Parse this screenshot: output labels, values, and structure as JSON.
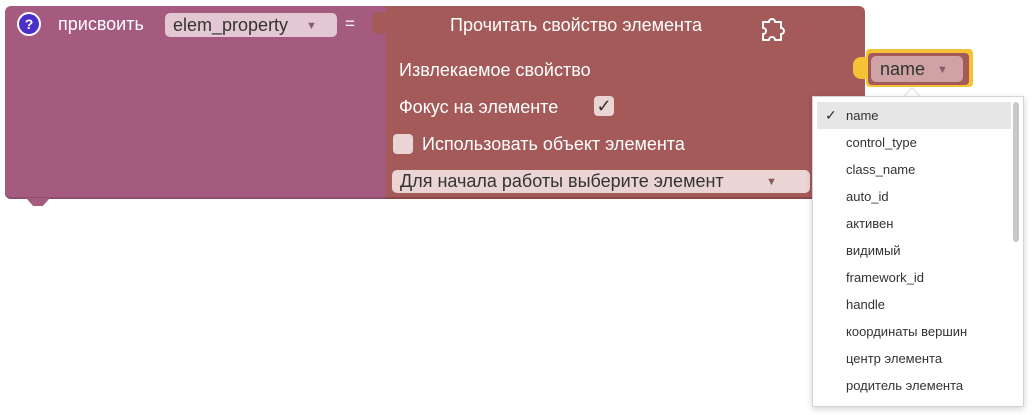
{
  "set_block": {
    "help_icon": "?",
    "label": "присвоить",
    "variable": "elem_property",
    "equals": "="
  },
  "read_block": {
    "title": "Прочитать свойство элемента",
    "property_label": "Извлекаемое свойство",
    "property_value": "name",
    "focus_label": "Фокус на элементе",
    "focus_checked": "✓",
    "use_object_label": "Использовать объект элемента",
    "element_select": "Для начала работы выберите элемент",
    "dropdown_arrow": "▼"
  },
  "dropdown": {
    "selected_index": 0,
    "items": [
      "name",
      "control_type",
      "class_name",
      "auto_id",
      "активен",
      "видимый",
      "framework_id",
      "handle",
      "координаты вершин",
      "центр элемента",
      "родитель элемента"
    ]
  },
  "colors": {
    "set_block": "#a55b80",
    "read_block": "#a55a5a",
    "highlight": "#f6c235",
    "help_icon": "#4a2fc9"
  }
}
